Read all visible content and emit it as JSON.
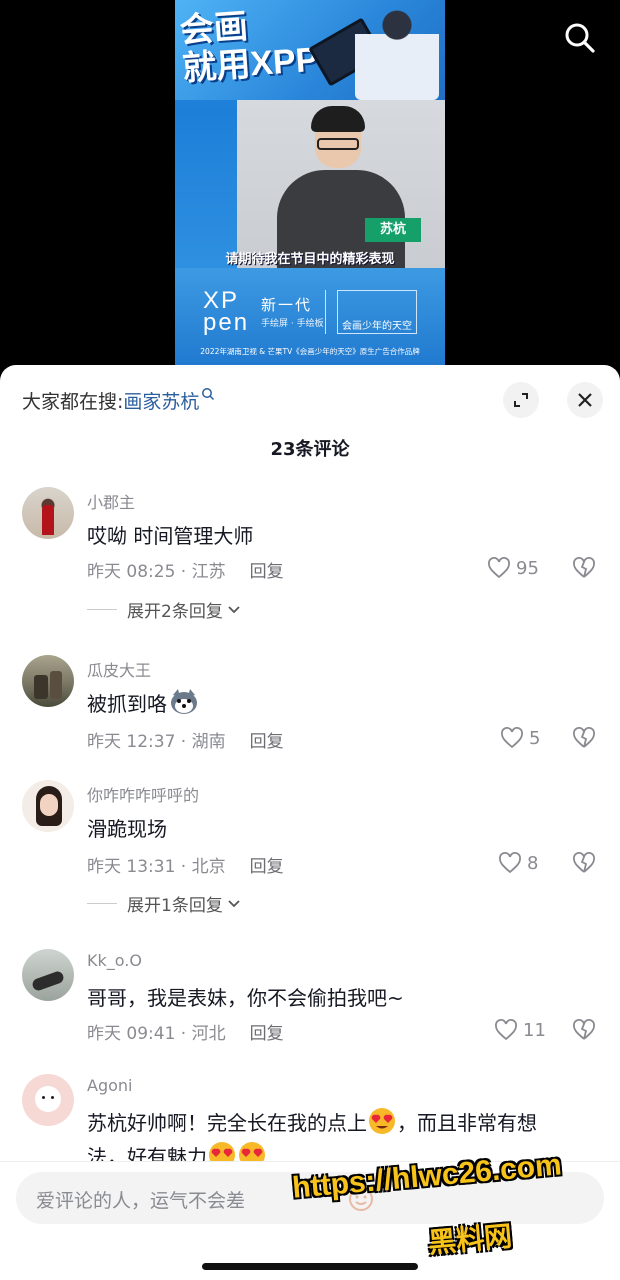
{
  "video": {
    "headline": "会画\n就用XPPen",
    "name_tag": "苏杭",
    "subtitle": "请期待我在节目中的精彩表现",
    "brand_logo": "XP\npen",
    "brand_new": "新一代",
    "brand_sub": "手绘屏 · 手绘板",
    "show_name": "会画少年的天空",
    "footer": "2022年湖南卫视 & 芒果TV《会画少年的天空》原生广告合作品牌"
  },
  "top_search_icon": "search-icon",
  "sheet": {
    "hot_search_label": "大家都在搜:",
    "hot_search_keyword": "画家苏杭",
    "comment_count_title": "23条评论"
  },
  "comments": [
    {
      "user": "小郡主",
      "text": "哎呦 时间管理大师",
      "meta": "昨天 08:25 · 江苏",
      "reply": "回复",
      "likes": "95",
      "expand": "展开2条回复"
    },
    {
      "user": "瓜皮大王",
      "text": "被抓到咯",
      "meta": "昨天 12:37 · 湖南",
      "reply": "回复",
      "likes": "5",
      "emoji": "husky-emoji"
    },
    {
      "user": "你咋咋咋呼呼的",
      "text": "滑跪现场",
      "meta": "昨天 13:31 · 北京",
      "reply": "回复",
      "likes": "8",
      "expand": "展开1条回复"
    },
    {
      "user": "Kk_o.O",
      "text": "哥哥，我是表妹，你不会偷拍我吧~",
      "meta": "昨天 09:41 · 河北",
      "reply": "回复",
      "likes": "11"
    },
    {
      "user": "Agoni",
      "text_part1": "苏杭好帅啊！完全长在我的点上",
      "text_part2": "，而且非常有想",
      "text_line2": "法，好有魅力",
      "emoji": "heart-eyes-emoji"
    }
  ],
  "input": {
    "placeholder": "爱评论的人，运气不会差"
  },
  "watermark": {
    "url": "https://hlwc26.com",
    "name": "黑料网"
  },
  "colors": {
    "keyword": "#2b5e9e",
    "meta": "#8a8b91",
    "text": "#161823"
  }
}
